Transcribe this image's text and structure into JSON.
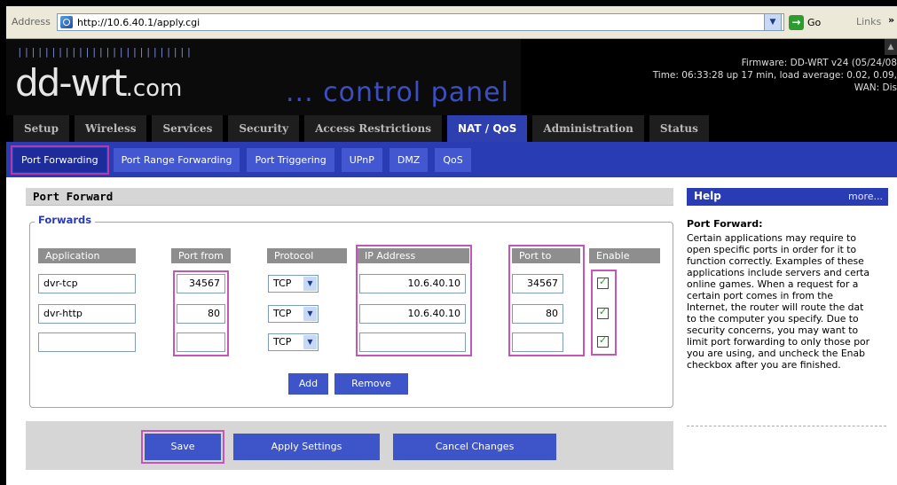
{
  "browser": {
    "address_label": "Address",
    "url": "http://10.6.40.1/apply.cgi",
    "go_label": "Go",
    "links_label": "Links",
    "more_chevron": "»"
  },
  "header": {
    "ticks": "||||||||||||||||||||||||||",
    "logo_main": "dd-wrt",
    "logo_suffix": ".com",
    "logo_cp": "... control panel",
    "firmware": "Firmware: DD-WRT v24 (05/24/08",
    "time": "Time: 06:33:28 up 17 min, load average: 0.02, 0.09,",
    "wan": "WAN: Dis"
  },
  "main_tabs": [
    {
      "label": "Setup"
    },
    {
      "label": "Wireless"
    },
    {
      "label": "Services"
    },
    {
      "label": "Security"
    },
    {
      "label": "Access Restrictions"
    },
    {
      "label": "NAT / QoS",
      "active": true
    },
    {
      "label": "Administration"
    },
    {
      "label": "Status"
    }
  ],
  "sub_tabs": [
    {
      "label": "Port Forwarding",
      "active": true
    },
    {
      "label": "Port Range Forwarding"
    },
    {
      "label": "Port Triggering"
    },
    {
      "label": "UPnP"
    },
    {
      "label": "DMZ"
    },
    {
      "label": "QoS"
    }
  ],
  "port_forward": {
    "section_title": "Port Forward",
    "legend": "Forwards",
    "columns": [
      "Application",
      "Port from",
      "Protocol",
      "IP Address",
      "Port to",
      "Enable"
    ],
    "rows": [
      {
        "application": "dvr-tcp",
        "port_from": "34567",
        "protocol": "TCP",
        "ip": "10.6.40.10",
        "port_to": "34567",
        "enabled": true
      },
      {
        "application": "dvr-http",
        "port_from": "80",
        "protocol": "TCP",
        "ip": "10.6.40.10",
        "port_to": "80",
        "enabled": true
      },
      {
        "application": "",
        "port_from": "",
        "protocol": "TCP",
        "ip": "",
        "port_to": "",
        "enabled": true
      }
    ],
    "add_label": "Add",
    "remove_label": "Remove",
    "save_label": "Save",
    "apply_label": "Apply Settings",
    "cancel_label": "Cancel Changes"
  },
  "help": {
    "title": "Help",
    "more": "more...",
    "heading": "Port Forward:",
    "body_lines": [
      "Certain applications may require to",
      "open specific ports in order for it to",
      "function correctly. Examples of these",
      "applications include servers and certa",
      "online games. When a request for a",
      "certain port comes in from the",
      "Internet, the router will route the dat",
      "to the computer you specify. Due to",
      "security concerns, you may want to",
      "limit port forwarding to only those por",
      "you are using, and uncheck the Enab",
      "checkbox after you are finished."
    ]
  },
  "colors": {
    "accent": "#2a3cb4",
    "highlight": "#c456b5"
  }
}
